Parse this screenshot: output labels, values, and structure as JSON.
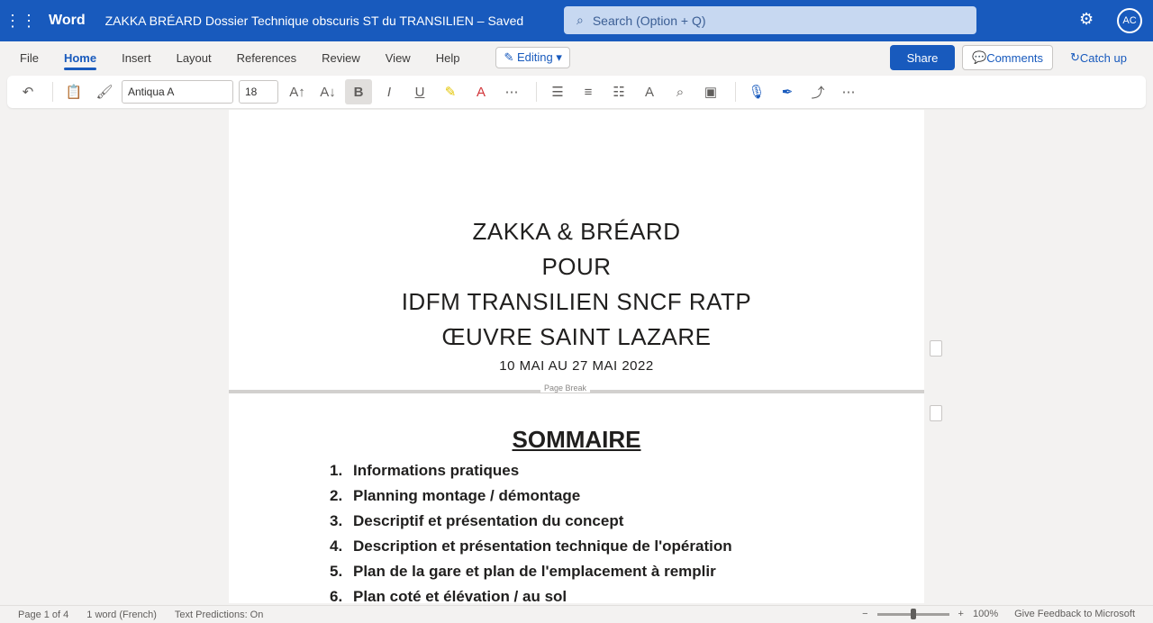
{
  "titlebar": {
    "app_name": "Word",
    "doc_title": "ZAKKA BRÉARD Dossier Technique obscuris ST du TRANSILIEN – Saved",
    "search_placeholder": "Search (Option + Q)",
    "avatar_initials": "AC",
    "color": "#185abd"
  },
  "ribbon": {
    "tabs": [
      "File",
      "Home",
      "Insert",
      "Layout",
      "References",
      "Review",
      "View",
      "Help"
    ],
    "active_tab": "Home",
    "editing_label": "Editing",
    "share_label": "Share",
    "comments_label": "Comments",
    "catchup_label": "Catch up"
  },
  "toolbar": {
    "font_name": "Antiqua A",
    "font_size": "18",
    "bold": "B",
    "italic": "I",
    "underline": "U"
  },
  "document": {
    "page1": {
      "line1": "ZAKKA & BRÉARD",
      "line2": "POUR",
      "line3": "IDFM TRANSILIEN SNCF RATP",
      "line4": "ŒUVRE SAINT LAZARE",
      "date": "10 MAI AU 27 MAI 2022",
      "page_break_label": "Page Break"
    },
    "page2": {
      "heading": "SOMMAIRE",
      "toc": [
        {
          "num": "1.",
          "text": "Informations pratiques"
        },
        {
          "num": "2.",
          "text": "Planning montage / démontage"
        },
        {
          "num": "3.",
          "text": "Descriptif et présentation du concept"
        },
        {
          "num": "4.",
          "text": "Description et présentation technique de l'opération"
        },
        {
          "num": "5.",
          "text": "Plan de la gare et plan de l'emplacement à remplir"
        },
        {
          "num": "6.",
          "text": "Plan coté et élévation / au sol"
        }
      ]
    }
  },
  "statusbar": {
    "page_info": "Page 1 of 4",
    "word_count": "1 word (French)",
    "text_predictions": "Text Predictions: On",
    "zoom": "100%",
    "zoom_level": 0.5,
    "feedback": "Give Feedback to Microsoft"
  }
}
